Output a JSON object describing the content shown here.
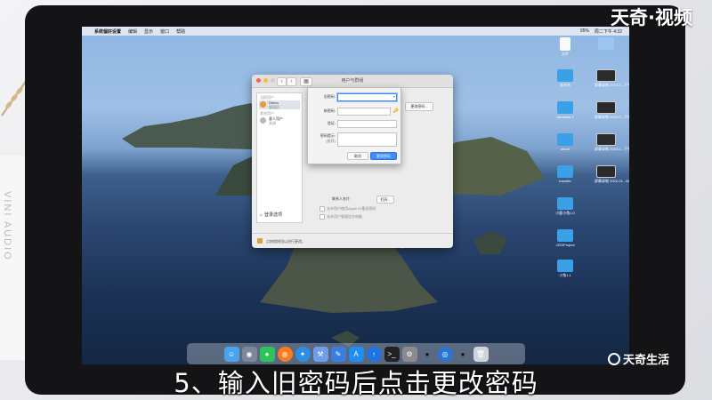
{
  "menubar": {
    "apple": "",
    "items": [
      "系统偏好设置",
      "编辑",
      "显示",
      "窗口",
      "帮助"
    ],
    "status": [
      "95%",
      "周二下午 4:32"
    ]
  },
  "window": {
    "title": "用户与群组",
    "sidebar": {
      "group_label": "当前用户",
      "current_user_name": "Demo",
      "current_user_role": "管理员",
      "other_group_label": "其他用户",
      "guest_name": "客人用户",
      "guest_status": "关闭",
      "login_options": "登录选项"
    },
    "change_password_button": "更改密码...",
    "contact_label": "联系人名片:",
    "open_button": "打开...",
    "checkbox1": "允许用户使用Apple ID重设密码",
    "checkbox2": "允许用户管理这台电脑",
    "lock_text": "点按锁按钮以进行更改。"
  },
  "sheet": {
    "old_password_label": "旧密码:",
    "new_password_label": "新密码:",
    "verify_label": "验证:",
    "hint_label": "密码提示:",
    "hint_sub": "(推荐)",
    "cancel_button": "取消",
    "change_button": "更改密码"
  },
  "desktop_icons": [
    {
      "label": "文件"
    },
    {
      "label": ""
    },
    {
      "label": "未命名"
    },
    {
      "label": "屏幕录制 2022-0...下午4.32.59"
    },
    {
      "label": "windows 7"
    },
    {
      "label": "屏幕录制 2022-0...下午4.40.17"
    },
    {
      "label": "uboot"
    },
    {
      "label": "屏幕录制 2022-0...下午4.44.17"
    },
    {
      "label": "transfer"
    },
    {
      "label": "屏幕录制 2022-01...08.mov"
    },
    {
      "label": "小鹿小兔1.0"
    },
    {
      "label": "JZGIProject"
    },
    {
      "label": "小兔1.1"
    }
  ],
  "caption": "5、输入旧密码后点击更改密码",
  "watermark_top": "天奇·视频",
  "watermark_bottom": "天奇生活",
  "paper_text": "VINI AUDIO",
  "colors": {
    "accent": "#3d8bf7",
    "lock": "#d8a23c",
    "folder": "#3aa0e8"
  }
}
